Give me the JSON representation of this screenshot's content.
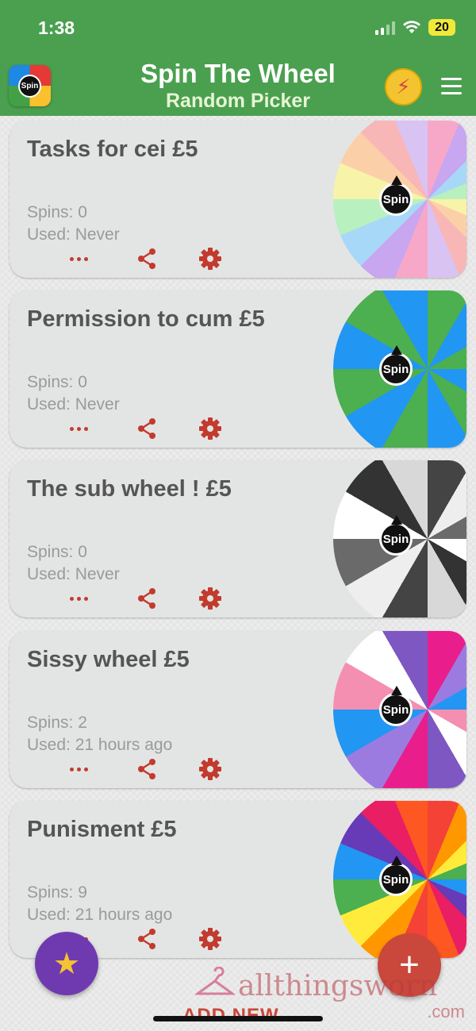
{
  "status_bar": {
    "time": "1:38",
    "battery": "20"
  },
  "header": {
    "title": "Spin The Wheel",
    "subtitle": "Random Picker",
    "logo_label": "Spin"
  },
  "cards": [
    {
      "title": "Tasks for cei £5",
      "spins": "Spins: 0",
      "used": "Used: Never",
      "wheel_colors": [
        "#f7a8c8",
        "#c9a6f0",
        "#a8d8f7",
        "#b8f0c0",
        "#f7f3a8",
        "#fbd0a8",
        "#f8b6b6",
        "#d9c3f3"
      ]
    },
    {
      "title": "Permission to cum £5",
      "spins": "Spins: 0",
      "used": "Used: Never",
      "wheel_colors": [
        "#4caf50",
        "#2196f3"
      ]
    },
    {
      "title": "The sub wheel ! £5",
      "spins": "Spins: 0",
      "used": "Used: Never",
      "wheel_colors": [
        "#444444",
        "#eeeeee",
        "#6a6a6a",
        "#ffffff",
        "#333333",
        "#d8d8d8"
      ]
    },
    {
      "title": "Sissy wheel £5",
      "spins": "Spins: 2",
      "used": "Used: 21 hours ago",
      "wheel_colors": [
        "#e91e8c",
        "#9c7be0",
        "#2196f3",
        "#f48fb1",
        "#ffffff",
        "#7e57c2"
      ]
    },
    {
      "title": "Punisment £5",
      "spins": "Spins: 9",
      "used": "Used: 21 hours ago",
      "wheel_colors": [
        "#f44336",
        "#ff9800",
        "#ffeb3b",
        "#4caf50",
        "#2196f3",
        "#673ab7",
        "#e91e63",
        "#ff5722"
      ]
    }
  ],
  "wheel_hub_label": "Spin",
  "fab": {
    "star": "★",
    "add": "+",
    "add_label": "ADD NEW"
  },
  "watermark": {
    "text": "allthingsworn",
    "suffix": ".com"
  },
  "colors": {
    "header": "#4aa04f",
    "accent": "#c23b2e",
    "card": "#e3e5e4"
  }
}
